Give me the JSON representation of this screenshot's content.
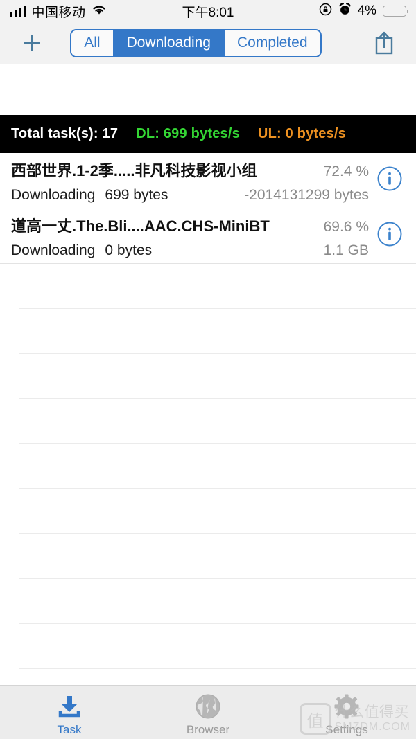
{
  "statusbar": {
    "carrier": "中国移动",
    "time": "下午8:01",
    "battery_percent": "4%",
    "battery_level": 7,
    "icons": {
      "signal": "signal-bars-icon",
      "wifi": "wifi-icon",
      "rotation_lock": "rotation-lock-icon",
      "alarm": "alarm-clock-icon",
      "battery": "battery-icon"
    }
  },
  "toolbar": {
    "add_label": "+",
    "share_label": "share",
    "segments": [
      {
        "label": "All",
        "active": false
      },
      {
        "label": "Downloading",
        "active": true
      },
      {
        "label": "Completed",
        "active": false
      }
    ]
  },
  "stats": {
    "total": "Total task(s): 17",
    "download": "DL: 699 bytes/s",
    "upload": "UL: 0 bytes/s",
    "colors": {
      "total": "#ffffff",
      "download": "#34d634",
      "upload": "#ed9121",
      "background": "#000000"
    }
  },
  "tasks": [
    {
      "name": "西部世界.1-2季.....非凡科技影视小组",
      "percent": "72.4 %",
      "state": "Downloading",
      "speed": "699 bytes",
      "size": "-2014131299 bytes",
      "info_label": "i"
    },
    {
      "name": "道高一丈.The.Bli....AAC.CHS-MiniBT",
      "percent": "69.6 %",
      "state": "Downloading",
      "speed": "0 bytes",
      "size": "1.1 GB",
      "info_label": "i"
    }
  ],
  "tabbar": {
    "tabs": [
      {
        "label": "Task",
        "icon": "download-icon",
        "active": true
      },
      {
        "label": "Browser",
        "icon": "globe-icon",
        "active": false
      },
      {
        "label": "Settings",
        "icon": "gear-icon",
        "active": false
      }
    ],
    "accent": "#3478c8",
    "inactive": "#9a9a9a"
  },
  "watermark": {
    "logo": "值",
    "cn": "什么值得买",
    "en": "SMZDM.COM"
  }
}
